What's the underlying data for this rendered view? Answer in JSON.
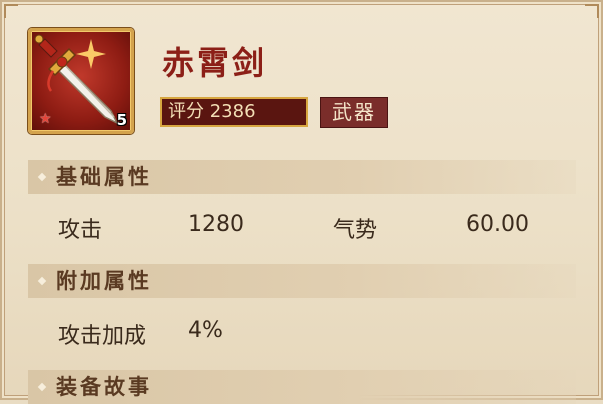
{
  "item": {
    "name": "赤霄剑",
    "score_label": "评分 2386",
    "type_label": "武器",
    "star_level": "5",
    "icon": "sword-icon"
  },
  "sections": {
    "basic_title": "基础属性",
    "extra_title": "附加属性",
    "story_title": "装备故事"
  },
  "basic_attributes": [
    {
      "name": "攻击",
      "value": "1280"
    },
    {
      "name": "气势",
      "value": "60.00"
    }
  ],
  "extra_attributes": [
    {
      "name": "攻击加成",
      "value": "4%"
    }
  ],
  "colors": {
    "name_red": "#8c1f17",
    "score_bg": "#5a1510",
    "badge_bg": "#7a2d2a",
    "panel_bg": "#ece0c7"
  }
}
